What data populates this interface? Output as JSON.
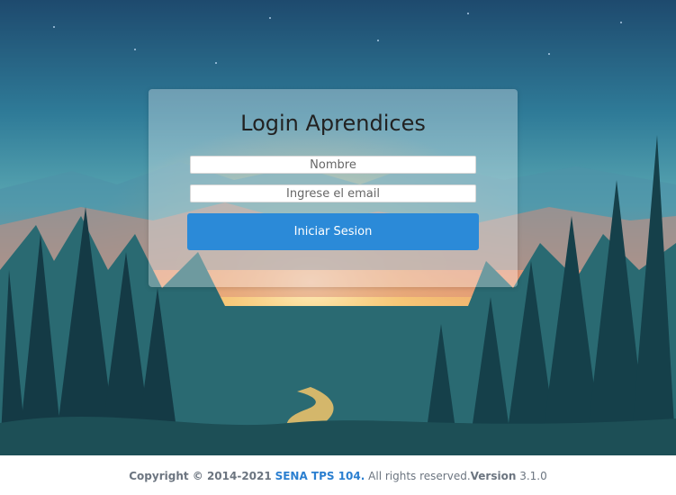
{
  "login": {
    "title": "Login Aprendices",
    "name_placeholder": "Nombre",
    "email_placeholder": "Ingrese el email",
    "submit_label": "Iniciar Sesion"
  },
  "footer": {
    "copyright": "Copyright © 2014-2021",
    "brand": "SENA TPS 104.",
    "rights": "All rights reserved.",
    "version_label": "Version",
    "version_number": "3.1.0"
  },
  "colors": {
    "button": "#2b8ad8",
    "brand": "#2b7fd0"
  }
}
